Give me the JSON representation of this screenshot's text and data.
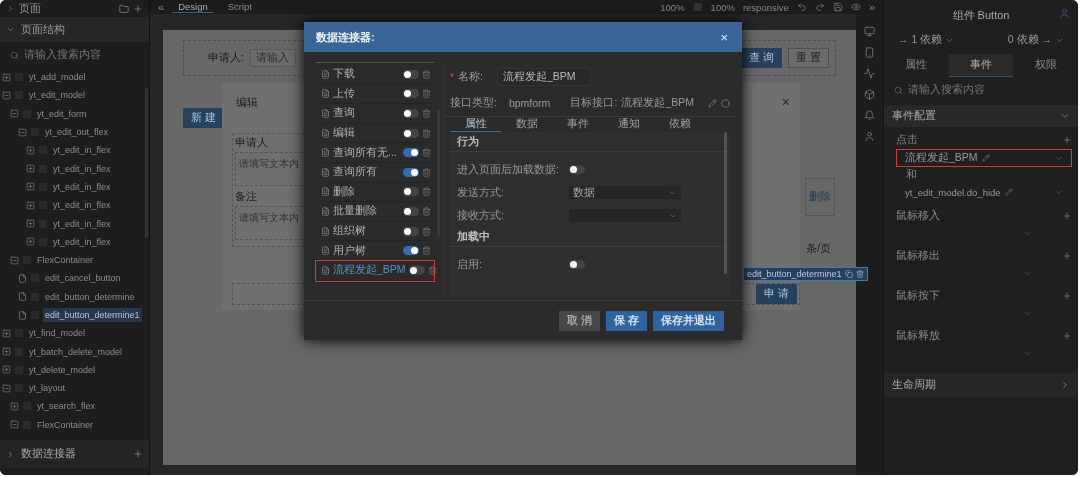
{
  "topbar": {
    "collapse": "«",
    "tabs": [
      {
        "label": "Design",
        "selected": true
      },
      {
        "label": "Script",
        "selected": false
      }
    ],
    "zoom_1": "100%",
    "zoom_2": "100%",
    "mode": "responsive",
    "expand": "»"
  },
  "sidebar": {
    "title": "页面",
    "section": {
      "title": "页面结构",
      "expanded": true
    },
    "search": {
      "placeholder": "请输入搜索内容"
    },
    "tree": [
      {
        "label": "yt_add_model",
        "kind": "group",
        "expanded": false,
        "selected": false
      },
      {
        "label": "yt_edit_model",
        "kind": "group",
        "expanded": true,
        "selected": false,
        "children": [
          {
            "label": "yt_edit_form",
            "kind": "group",
            "expanded": true,
            "selected": false,
            "children": [
              {
                "label": "yt_edit_out_flex",
                "kind": "group",
                "expanded": true,
                "selected": false,
                "children": [
                  {
                    "label": "yt_edit_in_flex",
                    "kind": "group",
                    "expanded": false,
                    "selected": false
                  },
                  {
                    "label": "yt_edit_in_flex",
                    "kind": "group",
                    "expanded": false,
                    "selected": false
                  },
                  {
                    "label": "yt_edit_in_flex",
                    "kind": "group",
                    "expanded": false,
                    "selected": false
                  },
                  {
                    "label": "yt_edit_in_flex",
                    "kind": "group",
                    "expanded": false,
                    "selected": false
                  },
                  {
                    "label": "yt_edit_in_flex",
                    "kind": "group",
                    "expanded": false,
                    "selected": false
                  },
                  {
                    "label": "yt_edit_in_flex",
                    "kind": "group",
                    "expanded": false,
                    "selected": false
                  }
                ]
              }
            ]
          },
          {
            "label": "FlexContainer",
            "kind": "group",
            "expanded": true,
            "selected": false,
            "children": [
              {
                "label": "edit_cancel_button",
                "kind": "leaf",
                "selected": false
              },
              {
                "label": "edit_button_determine",
                "kind": "leaf",
                "selected": false
              },
              {
                "label": "edit_button_determine1",
                "kind": "leaf",
                "selected": true
              }
            ]
          }
        ]
      },
      {
        "label": "yt_find_model",
        "kind": "group",
        "expanded": false,
        "selected": false
      },
      {
        "label": "yt_batch_delete_model",
        "kind": "group",
        "expanded": false,
        "selected": false
      },
      {
        "label": "yt_delete_model",
        "kind": "group",
        "expanded": false,
        "selected": false
      },
      {
        "label": "yt_layout",
        "kind": "group",
        "expanded": true,
        "selected": false,
        "children": [
          {
            "label": "yt_search_flex",
            "kind": "group",
            "expanded": false,
            "selected": false
          },
          {
            "label": "FlexContainer",
            "kind": "group",
            "expanded": true,
            "selected": false
          }
        ]
      }
    ],
    "footer": {
      "title": "数据连接器",
      "expanded": false
    }
  },
  "canvas": {
    "search_label": "申请人:",
    "search_placeholder": "请输入",
    "query_button": "查 询",
    "reset_button": "重 置",
    "new_button": "新 建",
    "delete_link": "删除",
    "page_size": "条/页",
    "edit_dialog": {
      "title": "编辑",
      "close": "×",
      "fields": [
        {
          "label": "申请人",
          "placeholder": "请填写文本内"
        },
        {
          "label": "备注",
          "placeholder": "请填写文本内"
        }
      ],
      "selection_label": "edit_button_determine1",
      "submit_button": "申 请"
    }
  },
  "dialog": {
    "title": "数据连接器:",
    "close": "×",
    "connectors": [
      {
        "label": "下载",
        "on": false,
        "selected": false
      },
      {
        "label": "上传",
        "on": false,
        "selected": false
      },
      {
        "label": "查询",
        "on": false,
        "selected": false
      },
      {
        "label": "编辑",
        "on": false,
        "selected": false
      },
      {
        "label": "查询所有无...",
        "on": true,
        "selected": false
      },
      {
        "label": "查询所有",
        "on": true,
        "selected": false
      },
      {
        "label": "删除",
        "on": false,
        "selected": false
      },
      {
        "label": "批量删除",
        "on": false,
        "selected": false
      },
      {
        "label": "组织树",
        "on": false,
        "selected": false
      },
      {
        "label": "用户树",
        "on": true,
        "selected": false
      },
      {
        "label": "流程发起_BPM",
        "on": false,
        "selected": true
      }
    ],
    "required_mark": "*",
    "name_label": "名称:",
    "name_value": "流程发起_BPM",
    "type_label": "接口类型:",
    "type_value": "bpmform",
    "target_label": "目标接口:",
    "target_value": "流程发起_BPM",
    "tabs": [
      {
        "label": "属性",
        "selected": true
      },
      {
        "label": "数据",
        "selected": false
      },
      {
        "label": "事件",
        "selected": false
      },
      {
        "label": "通知",
        "selected": false
      },
      {
        "label": "依赖",
        "selected": false
      }
    ],
    "sections": [
      {
        "title": "行为",
        "rows": [
          {
            "kind": "toggle",
            "label": "进入页面后加载数据:",
            "on": false
          },
          {
            "kind": "select",
            "label": "发送方式:",
            "value": "数据"
          },
          {
            "kind": "select",
            "label": "接收方式:"
          }
        ]
      },
      {
        "title": "加载中",
        "rows": [
          {
            "kind": "toggle",
            "label": "启用:",
            "on": false
          }
        ]
      }
    ],
    "buttons": [
      {
        "label": "取 消",
        "kind": "secondary"
      },
      {
        "label": "保 存",
        "kind": "primary"
      },
      {
        "label": "保存并退出",
        "kind": "primary"
      }
    ]
  },
  "right_panel": {
    "title": "组件 Button",
    "deps_in": "→ 1 依赖",
    "deps_out": "0 依赖 →",
    "tabs": [
      {
        "label": "属性",
        "selected": false
      },
      {
        "label": "事件",
        "selected": true
      },
      {
        "label": "权限",
        "selected": false
      }
    ],
    "search": {
      "placeholder": "请输入搜索内容"
    },
    "section": {
      "title": "事件配置",
      "expanded": true
    },
    "events": [
      {
        "label": "点击",
        "actions": [
          {
            "label": "流程发起_BPM",
            "highlighted": true
          },
          {
            "label": "yt_edit_model.do_hide",
            "highlighted": false
          }
        ],
        "joiner": "和"
      },
      {
        "label": "鼠标移入"
      },
      {
        "label": "鼠标移出"
      },
      {
        "label": "鼠标按下"
      },
      {
        "label": "鼠标释放"
      }
    ],
    "lifecycle": {
      "title": "生命周期",
      "expanded": false
    }
  }
}
